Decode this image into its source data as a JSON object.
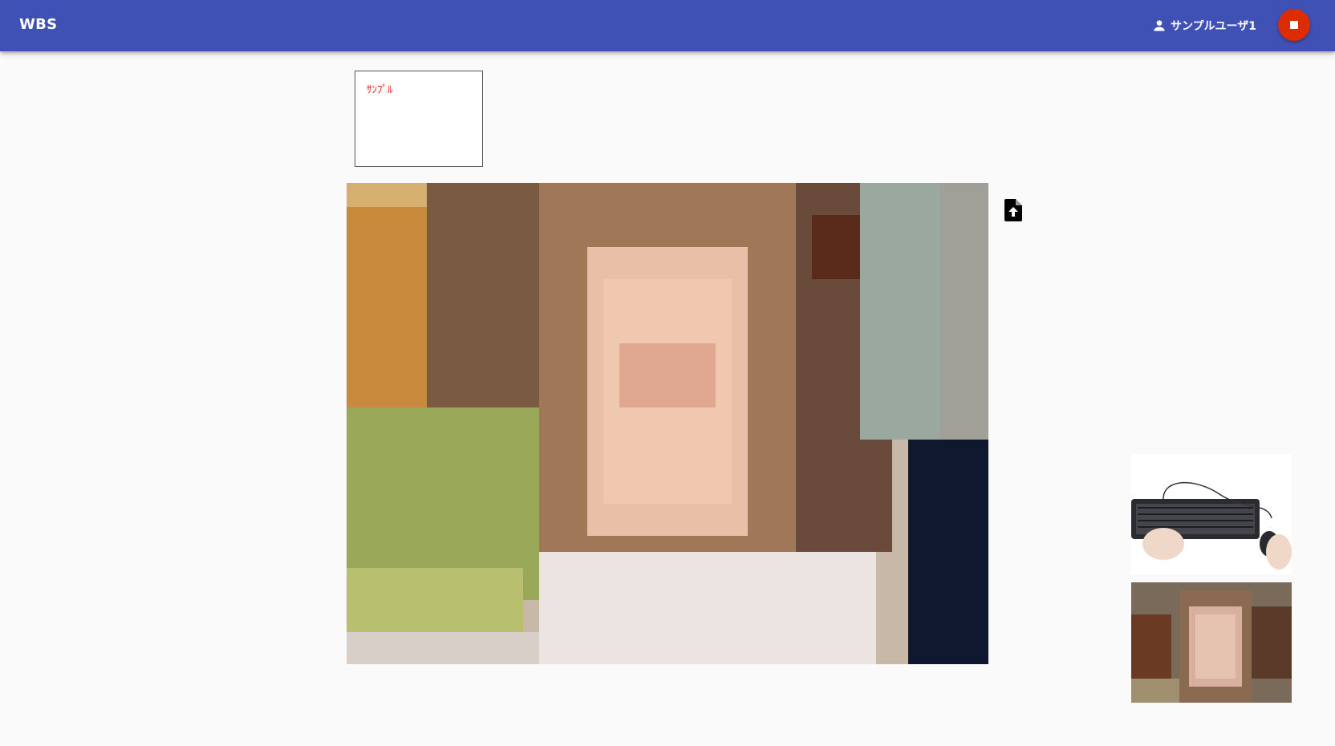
{
  "header": {
    "title": "WBS",
    "user_icon": "person-icon",
    "user_name": "サンプルユーザ1",
    "stop_icon": "stop-icon",
    "bar_color": "#3f51b5",
    "stop_color": "#dd2c00"
  },
  "sticky_note": {
    "text": "ｻﾝﾌﾟﾙ",
    "text_color": "#e02020"
  },
  "main_video": {
    "content": "pixelated webcam feed of a person"
  },
  "upload": {
    "icon": "file-upload-icon"
  },
  "thumbnails": [
    {
      "content": "keyboard and mouse with hands"
    },
    {
      "content": "pixelated webcam feed of a person"
    }
  ]
}
